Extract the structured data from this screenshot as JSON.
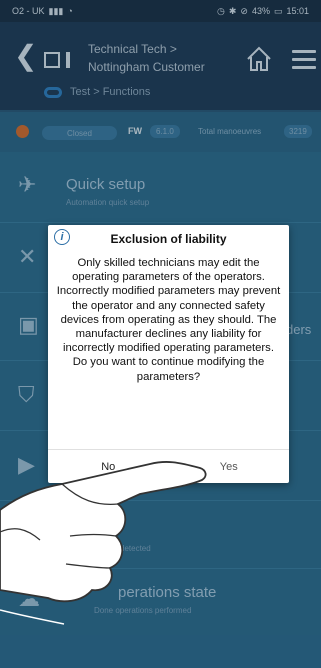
{
  "status_bar": {
    "carrier": "O2 - UK",
    "battery": "43%",
    "time": "15:01"
  },
  "header": {
    "title_line1": "Technical Tech >",
    "title_line2": "Nottingham Customer",
    "subtitle": "Test > Functions"
  },
  "status_row": {
    "state": "Closed",
    "fw_label": "FW",
    "fw_value": "6.1.0",
    "total_label": "Total manoeuvres",
    "total_value": "3219"
  },
  "list": {
    "quick_setup_title": "Quick setup",
    "quick_setup_sub": "Automation quick setup",
    "partial_right": "ders",
    "partial_sub": "detected",
    "operations_title": "perations state",
    "operations_sub": "Done operations performed"
  },
  "dialog": {
    "title": "Exclusion of liability",
    "text": "Only skilled technicians may edit the operating parameters of the operators. Incorrectly modified parameters may prevent the operator and any connected safety devices from operating as they should. The manufacturer declines any liability for incorrectly modified operating parameters. Do you want to continue modifying the parameters?",
    "no_label": "No",
    "yes_label": "Yes"
  }
}
